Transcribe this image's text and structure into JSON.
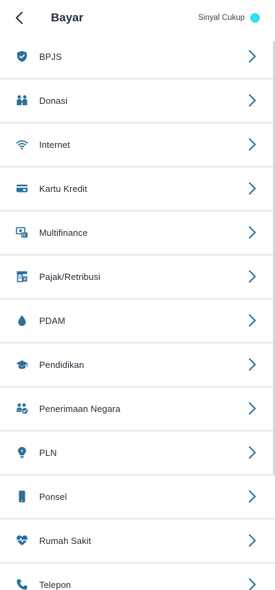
{
  "header": {
    "title": "Bayar",
    "signal_text": "Sinyal Cukup",
    "signal_color": "#2fe0ef"
  },
  "accent_color": "#2b6e9b",
  "items": [
    {
      "label": "BPJS",
      "icon": "shield-check-icon"
    },
    {
      "label": "Donasi",
      "icon": "people-donate-icon"
    },
    {
      "label": "Internet",
      "icon": "wifi-icon"
    },
    {
      "label": "Kartu Kredit",
      "icon": "credit-card-icon"
    },
    {
      "label": "Multifinance",
      "icon": "multifinance-icon"
    },
    {
      "label": "Pajak/Retribusi",
      "icon": "tax-building-icon"
    },
    {
      "label": "PDAM",
      "icon": "water-drop-icon"
    },
    {
      "label": "Pendidikan",
      "icon": "graduation-cap-icon"
    },
    {
      "label": "Penerimaan Negara",
      "icon": "state-revenue-icon"
    },
    {
      "label": "PLN",
      "icon": "lightbulb-icon"
    },
    {
      "label": "Ponsel",
      "icon": "phone-device-icon"
    },
    {
      "label": "Rumah Sakit",
      "icon": "heart-pulse-icon"
    },
    {
      "label": "Telepon",
      "icon": "telephone-icon"
    }
  ]
}
